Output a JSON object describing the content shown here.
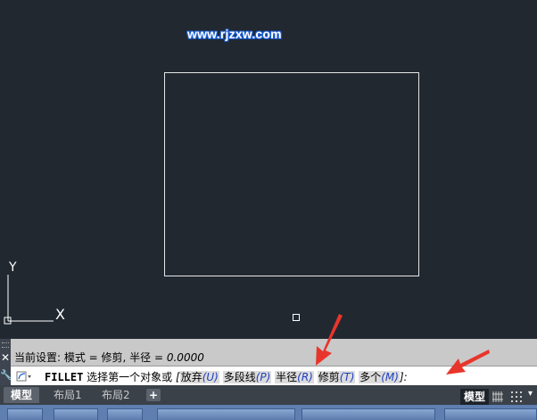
{
  "watermark": "www.rjzxw.com",
  "ucs": {
    "y_label": "Y",
    "x_label": "X"
  },
  "command": {
    "history_prefix": "当前设置: 模式 = 修剪, 半径 = ",
    "history_value": "0.0000",
    "name": "FILLET",
    "prompt": " 选择第一个对象或 ",
    "bracket_open": "[",
    "options": [
      {
        "label": "放弃",
        "key": "(U)"
      },
      {
        "label": "多段线",
        "key": "(P)"
      },
      {
        "label": "半径",
        "key": "(R)"
      },
      {
        "label": "修剪",
        "key": "(T)"
      },
      {
        "label": "多个",
        "key": "(M)"
      }
    ],
    "bracket_close": "]:"
  },
  "side_panel": {
    "close_icon": "close-icon",
    "settings_icon": "wrench-icon"
  },
  "tabs": [
    {
      "label": "模型",
      "active": true
    },
    {
      "label": "布局1",
      "active": false
    },
    {
      "label": "布局2",
      "active": false
    }
  ],
  "add_tab": "+",
  "status": {
    "model_label": "模型",
    "grid_icon": "grid-icon",
    "snap_icon": "snap-icon"
  },
  "annotations": {
    "arrow_color": "#e8352b"
  }
}
